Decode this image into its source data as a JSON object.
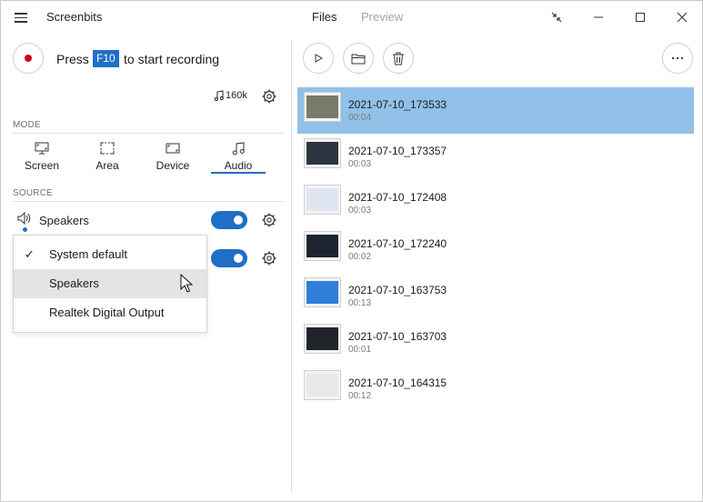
{
  "app": {
    "title": "Screenbits"
  },
  "top_tabs": {
    "files": "Files",
    "preview": "Preview"
  },
  "recorder": {
    "press_label": "Press",
    "key": "F10",
    "suffix_label": "to start recording",
    "bitrate": "160k"
  },
  "mode": {
    "section_label": "MODE",
    "tabs": [
      {
        "label": "Screen",
        "icon": "screen-icon"
      },
      {
        "label": "Area",
        "icon": "area-icon"
      },
      {
        "label": "Device",
        "icon": "device-icon"
      },
      {
        "label": "Audio",
        "icon": "audio-icon",
        "selected": true
      }
    ]
  },
  "source": {
    "section_label": "SOURCE",
    "speaker_label": "Speakers",
    "dropdown": {
      "items": [
        {
          "label": "System default",
          "checked": true
        },
        {
          "label": "Speakers",
          "hovered": true
        },
        {
          "label": "Realtek Digital Output"
        }
      ]
    }
  },
  "files": [
    {
      "name": "2021-07-10_173533",
      "duration": "00:04",
      "selected": true,
      "thumb": "#7a7a6a"
    },
    {
      "name": "2021-07-10_173357",
      "duration": "00:03",
      "thumb": "#2b3440"
    },
    {
      "name": "2021-07-10_172408",
      "duration": "00:03",
      "thumb": "#dfe6f2"
    },
    {
      "name": "2021-07-10_172240",
      "duration": "00:02",
      "thumb": "#1d2430"
    },
    {
      "name": "2021-07-10_163753",
      "duration": "00:13",
      "thumb": "#2f7fd9"
    },
    {
      "name": "2021-07-10_163703",
      "duration": "00:01",
      "thumb": "#20242a"
    },
    {
      "name": "2021-07-10_164315",
      "duration": "00:12",
      "thumb": "#e9e9e9"
    }
  ],
  "colors": {
    "accent": "#1f6fc6",
    "selection": "#91c0e8",
    "record": "#d0021b"
  }
}
